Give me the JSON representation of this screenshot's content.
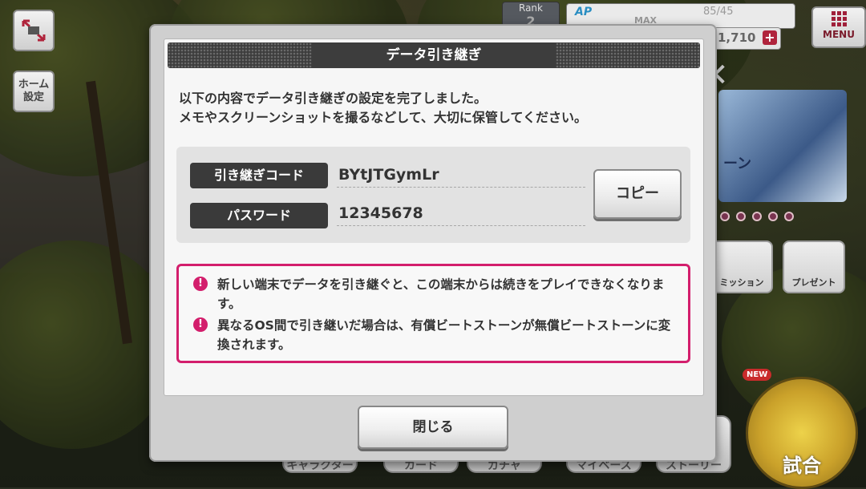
{
  "hud": {
    "home_label_1": "ホーム",
    "home_label_2": "設定",
    "menu_label": "MENU",
    "rank_label": "Rank",
    "rank_value": "2",
    "ap_label": "AP",
    "ap_max_label": "MAX",
    "ap_value": "85/45",
    "coins": "1,710",
    "plus_icon": "+"
  },
  "background": {
    "banner_text": "ーン",
    "mission_label": "ミッション",
    "present_label": "プレゼント",
    "nav": {
      "chara": "キャラクター",
      "card": "カード",
      "gacha": "ガチャ",
      "mybase": "マイベース",
      "story": "ストーリー"
    },
    "new_badge": "NEW",
    "match_label": "試合",
    "close_icon": "✕"
  },
  "dialog": {
    "title": "データ引き継ぎ",
    "message_line1": "以下の内容でデータ引き継ぎの設定を完了しました。",
    "message_line2": "メモやスクリーンショットを撮るなどして、大切に保管してください。",
    "transfer_code_label": "引き継ぎコード",
    "transfer_code_value": "BYtJTGymLr",
    "password_label": "パスワード",
    "password_value": "12345678",
    "copy_button": "コピー",
    "warnings": [
      "新しい端末でデータを引き継ぐと、この端末からは続きをプレイできなくなります。",
      "異なるOS間で引き継いだ場合は、有償ビートストーンが無償ビートストーンに変換されます。"
    ],
    "warning_icon": "!",
    "close_button": "閉じる"
  },
  "colors": {
    "accent_warning": "#d31e6c",
    "header_bg": "#3d3d3d"
  }
}
